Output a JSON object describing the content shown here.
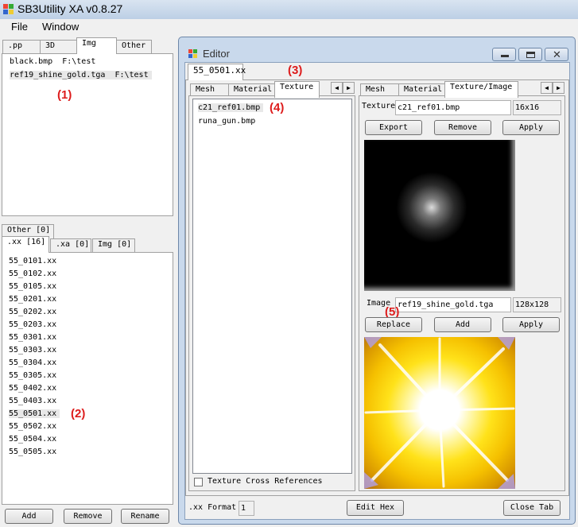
{
  "app": {
    "title": "SB3Utility XA v0.8.27",
    "menu": [
      "File",
      "Window"
    ]
  },
  "left": {
    "top_tabs": [
      ".pp",
      "3D",
      "Img",
      "Other"
    ],
    "image_list": [
      "black.bmp  F:\\test",
      "ref19_shine_gold.tga  F:\\test"
    ],
    "label1": "(1)",
    "other_tab": "Other [0]",
    "bottom_tabs": [
      ".xx [16]",
      ".xa [0]",
      "Img [0]"
    ],
    "xx_files": [
      "55_0101.xx",
      "55_0102.xx",
      "55_0105.xx",
      "55_0201.xx",
      "55_0202.xx",
      "55_0203.xx",
      "55_0301.xx",
      "55_0303.xx",
      "55_0304.xx",
      "55_0305.xx",
      "55_0402.xx",
      "55_0403.xx",
      "55_0501.xx",
      "55_0502.xx",
      "55_0504.xx",
      "55_0505.xx"
    ],
    "label2": "(2)",
    "buttons": [
      "Add",
      "Remove",
      "Rename"
    ]
  },
  "editor": {
    "title": "Editor",
    "file_tab": "55_0501.xx",
    "label3": "(3)",
    "left_tabs": [
      "Mesh",
      "Material",
      "Texture"
    ],
    "textures": [
      "c21_ref01.bmp",
      "runa_gun.bmp"
    ],
    "label4": "(4)",
    "cross_ref_label": "Texture Cross References",
    "right_tabs": [
      "Mesh",
      "Material",
      "Texture/Image"
    ],
    "texture_label": "Texture",
    "texture_name": "c21_ref01.bmp",
    "texture_size": "16x16",
    "texture_buttons": [
      "Export",
      "Remove",
      "Apply"
    ],
    "image_label": "Image",
    "image_name": "ref19_shine_gold.tga",
    "image_size": "128x128",
    "label5": "(5)",
    "image_buttons": [
      "Replace",
      "Add",
      "Apply"
    ],
    "format_label": ".xx Format",
    "format_value": "1",
    "edit_hex": "Edit Hex",
    "close_tab": "Close Tab"
  },
  "colors": {
    "annotation": "#dd1c1c",
    "selected_row": "#e8e8e8"
  }
}
